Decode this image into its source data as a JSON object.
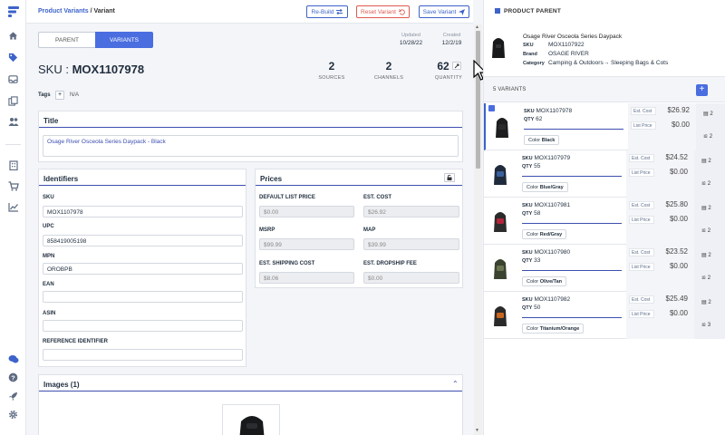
{
  "breadcrumb": {
    "parent": "Product Variants",
    "separator": " / ",
    "current": "Variant"
  },
  "toolbar": {
    "rebuild": "Re-Build",
    "reset": "Reset Variant",
    "save": "Save Variant"
  },
  "tabs": [
    {
      "label": "PARENT",
      "active": false
    },
    {
      "label": "VARIANTS",
      "active": true
    }
  ],
  "meta": {
    "updated_label": "Updated",
    "updated_value": "10/28/22",
    "created_label": "Created",
    "created_value": "12/2/19"
  },
  "sku_header": {
    "prefix": "SKU : ",
    "value": "MOX1107978"
  },
  "stats": [
    {
      "value": "2",
      "label": "SOURCES"
    },
    {
      "value": "2",
      "label": "CHANNELS"
    },
    {
      "value": "62",
      "label": "QUANTITY"
    }
  ],
  "tags": {
    "label": "Tags",
    "add": "+",
    "value": "N/A"
  },
  "title_card": {
    "heading": "Title",
    "value": "Osage River Osceola Series Daypack - Black"
  },
  "identifiers": {
    "heading": "Identifiers",
    "fields": [
      {
        "label": "SKU",
        "value": "MOX1107978"
      },
      {
        "label": "UPC",
        "value": "858419005198"
      },
      {
        "label": "MPN",
        "value": "OROBPB"
      },
      {
        "label": "EAN",
        "value": ""
      },
      {
        "label": "ASIN",
        "value": ""
      },
      {
        "label": "REFERENCE IDENTIFIER",
        "value": ""
      }
    ]
  },
  "prices": {
    "heading": "Prices",
    "fields": [
      {
        "label": "DEFAULT LIST PRICE",
        "value": "$0.00"
      },
      {
        "label": "EST. COST",
        "value": "$26.92"
      },
      {
        "label": "MSRP",
        "value": "$99.99"
      },
      {
        "label": "MAP",
        "value": "$39.99"
      },
      {
        "label": "EST. SHIPPING COST",
        "value": "$8.06"
      },
      {
        "label": "EST. DROPSHIP FEE",
        "value": "$0.00"
      }
    ]
  },
  "images": {
    "heading": "Images (1)"
  },
  "parent": {
    "heading": "PRODUCT PARENT",
    "title": "Osage River Osceola Series Daypack",
    "rows": [
      {
        "key": "SKU",
        "value": "MOX1107922"
      },
      {
        "key": "Brand",
        "value": "OSAGE RIVER"
      },
      {
        "key": "Category",
        "value": "Camping & Outdoors→ Sleeping Bags & Cots"
      }
    ]
  },
  "variants_header": {
    "label": "5 VARIANTS",
    "add": "+"
  },
  "variants": [
    {
      "sku": "MOX1107978",
      "qty": "62",
      "est_cost": "$26.92",
      "list_price": "$0.00",
      "color": "Black",
      "sources": "2",
      "channels": "2",
      "bag_color": "#1d1d1f",
      "accent": "#2a2a2a"
    },
    {
      "sku": "MOX1107979",
      "qty": "55",
      "est_cost": "$24.52",
      "list_price": "$0.00",
      "color": "Blue/Gray",
      "sources": "2",
      "channels": "2",
      "bag_color": "#1f2a3a",
      "accent": "#3a5f9c"
    },
    {
      "sku": "MOX1107981",
      "qty": "58",
      "est_cost": "$25.80",
      "list_price": "$0.00",
      "color": "Red/Gray",
      "sources": "2",
      "channels": "2",
      "bag_color": "#2b2b2b",
      "accent": "#b1243a"
    },
    {
      "sku": "MOX1107980",
      "qty": "33",
      "est_cost": "$23.52",
      "list_price": "$0.00",
      "color": "Olive/Tan",
      "sources": "2",
      "channels": "2",
      "bag_color": "#3a4230",
      "accent": "#6b7350"
    },
    {
      "sku": "MOX1107982",
      "qty": "50",
      "est_cost": "$25.49",
      "list_price": "$0.00",
      "color": "Titanium/Orange",
      "sources": "2",
      "channels": "3",
      "bag_color": "#2a2a2a",
      "accent": "#c8661f"
    }
  ],
  "variant_labels": {
    "sku": "SKU",
    "qty": "QTY",
    "est_cost": "Est. Cost",
    "list_price": "List Price",
    "color": "Color"
  },
  "colors": {
    "accent": "#3d63c9",
    "reset": "#e05a4f",
    "nav_blue": "#3d63c9"
  }
}
